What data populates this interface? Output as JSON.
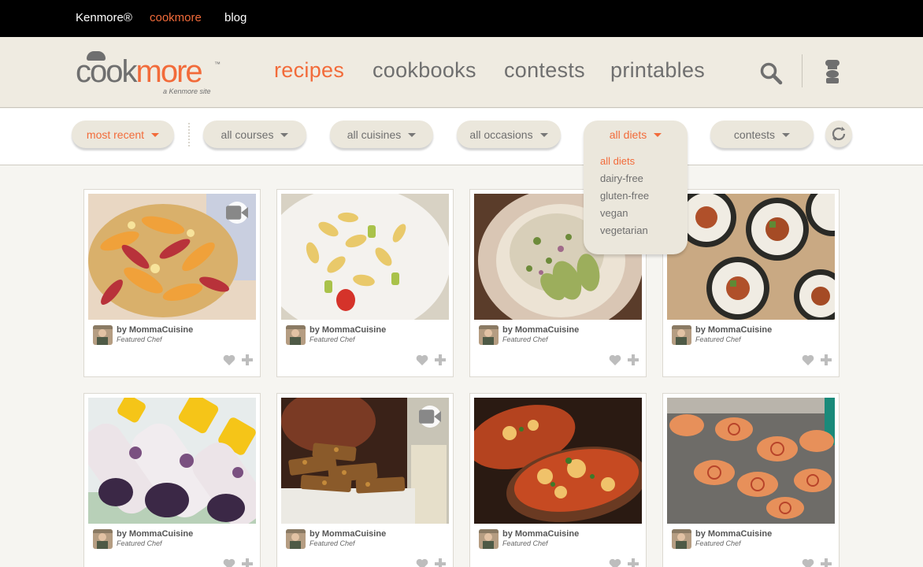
{
  "topbar": {
    "kenmore": "Kenmore®",
    "cookmore": "cookmore",
    "blog": "blog"
  },
  "logo": {
    "part1": "cook",
    "part2": "more",
    "tm": "™",
    "tagline": "a Kenmore site"
  },
  "nav": {
    "recipes": "recipes",
    "cookbooks": "cookbooks",
    "contests": "contests",
    "printables": "printables"
  },
  "filters": {
    "sort": "most recent",
    "courses": "all courses",
    "cuisines": "all cuisines",
    "occasions": "all occasions",
    "diets": "all diets",
    "contests": "contests"
  },
  "diet_dropdown": {
    "open": true,
    "selected": "all diets",
    "options": [
      "all diets",
      "dairy-free",
      "gluten-free",
      "vegan",
      "vegetarian"
    ]
  },
  "colors": {
    "accent": "#f26b3a",
    "topbar": "#000000",
    "header_bg": "#efebe1",
    "pill_bg": "#ebe7dc",
    "page_bg": "#f6f5f1"
  },
  "cards": [
    {
      "author": "by MommaCuisine",
      "role": "Featured Chef",
      "photo": "fruit-galette",
      "video": true
    },
    {
      "author": "by MommaCuisine",
      "role": "Featured Chef",
      "photo": "pasta-salad",
      "video": false
    },
    {
      "author": "by MommaCuisine",
      "role": "Featured Chef",
      "photo": "avocado-grain-salad",
      "video": false
    },
    {
      "author": "by MommaCuisine",
      "role": "Featured Chef",
      "photo": "sushi-rolls",
      "video": false
    },
    {
      "author": "by MommaCuisine",
      "role": "Featured Chef",
      "photo": "berry-popsicles",
      "video": false
    },
    {
      "author": "by MommaCuisine",
      "role": "Featured Chef",
      "photo": "granola-bars",
      "video": true
    },
    {
      "author": "by MommaCuisine",
      "role": "Featured Chef",
      "photo": "stuffed-potatoes",
      "video": false
    },
    {
      "author": "by MommaCuisine",
      "role": "Featured Chef",
      "photo": "pinwheels",
      "video": false
    }
  ]
}
